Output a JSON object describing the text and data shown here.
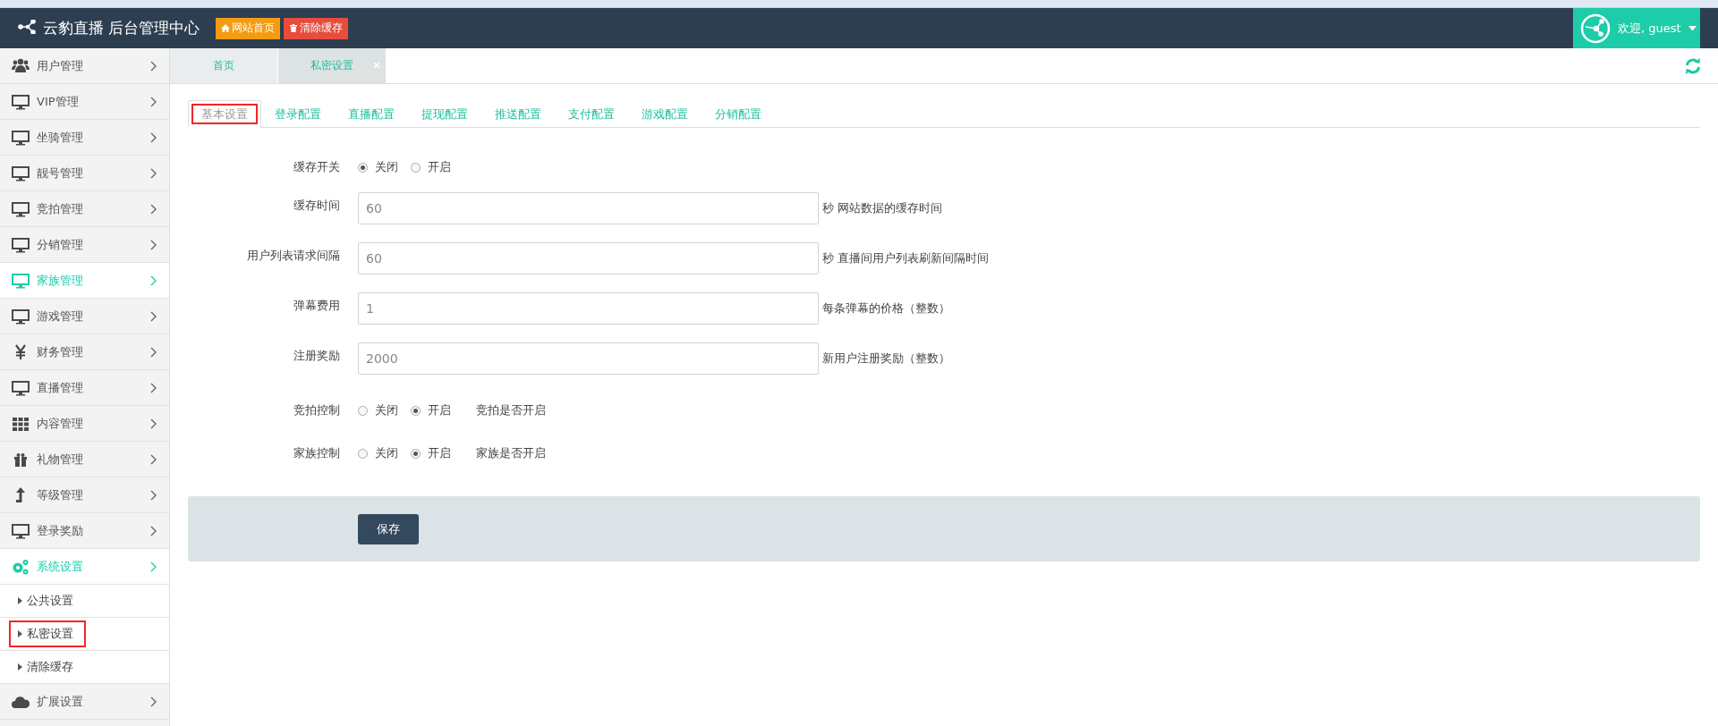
{
  "header": {
    "title": "云豹直播 后台管理中心",
    "buttons": [
      {
        "label": "网站首页",
        "kind": "home"
      },
      {
        "label": "清除缓存",
        "kind": "clear"
      }
    ],
    "user": {
      "greeting": "欢迎, guest"
    }
  },
  "sidebar": {
    "items": [
      {
        "label": "用户管理",
        "kind": "users",
        "active": false
      },
      {
        "label": "VIP管理",
        "kind": "monitor",
        "active": false
      },
      {
        "label": "坐骑管理",
        "kind": "monitor",
        "active": false
      },
      {
        "label": "靓号管理",
        "kind": "monitor",
        "active": false
      },
      {
        "label": "竞拍管理",
        "kind": "monitor",
        "active": false
      },
      {
        "label": "分销管理",
        "kind": "monitor",
        "active": false
      },
      {
        "label": "家族管理",
        "kind": "monitor",
        "active": true
      },
      {
        "label": "游戏管理",
        "kind": "monitor",
        "active": false
      },
      {
        "label": "财务管理",
        "kind": "yen",
        "active": false
      },
      {
        "label": "直播管理",
        "kind": "monitor",
        "active": false
      },
      {
        "label": "内容管理",
        "kind": "grid",
        "active": false
      },
      {
        "label": "礼物管理",
        "kind": "gift",
        "active": false
      },
      {
        "label": "等级管理",
        "kind": "arrow",
        "active": false
      },
      {
        "label": "登录奖励",
        "kind": "monitor",
        "active": false
      },
      {
        "label": "系统设置",
        "kind": "gears",
        "active": true,
        "children": [
          {
            "label": "公共设置",
            "highlighted": false
          },
          {
            "label": "私密设置",
            "highlighted": true
          },
          {
            "label": "清除缓存",
            "highlighted": false
          }
        ]
      },
      {
        "label": "扩展设置",
        "kind": "cloud",
        "active": false
      }
    ]
  },
  "page_tabs": [
    {
      "label": "首页",
      "selected": false,
      "closable": false
    },
    {
      "label": "私密设置",
      "selected": true,
      "closable": true
    }
  ],
  "config_tabs": [
    {
      "label": "基本设置",
      "selected": true,
      "highlighted": true
    },
    {
      "label": "登录配置",
      "selected": false,
      "highlighted": false
    },
    {
      "label": "直播配置",
      "selected": false,
      "highlighted": false
    },
    {
      "label": "提现配置",
      "selected": false,
      "highlighted": false
    },
    {
      "label": "推送配置",
      "selected": false,
      "highlighted": false
    },
    {
      "label": "支付配置",
      "selected": false,
      "highlighted": false
    },
    {
      "label": "游戏配置",
      "selected": false,
      "highlighted": false
    },
    {
      "label": "分销配置",
      "selected": false,
      "highlighted": false
    }
  ],
  "form": {
    "rows": [
      {
        "kind": "radio",
        "label": "缓存开关",
        "options": [
          {
            "label": "关闭",
            "selected": true
          },
          {
            "label": "开启",
            "selected": false
          }
        ]
      },
      {
        "kind": "input",
        "label": "缓存时间",
        "value": "60",
        "hint": "秒 网站数据的缓存时间"
      },
      {
        "kind": "input",
        "label": "用户列表请求间隔",
        "value": "60",
        "hint": "秒 直播间用户列表刷新间隔时间"
      },
      {
        "kind": "input",
        "label": "弹幕费用",
        "value": "1",
        "hint": "每条弹幕的价格（整数）"
      },
      {
        "kind": "input",
        "label": "注册奖励",
        "value": "2000",
        "hint": "新用户注册奖励（整数）"
      },
      {
        "kind": "radio",
        "label": "竞拍控制",
        "options": [
          {
            "label": "关闭",
            "selected": false
          },
          {
            "label": "开启",
            "selected": true
          }
        ],
        "hint": "竞拍是否开启"
      },
      {
        "kind": "radio",
        "label": "家族控制",
        "options": [
          {
            "label": "关闭",
            "selected": false
          },
          {
            "label": "开启",
            "selected": true
          }
        ],
        "hint": "家族是否开启"
      }
    ],
    "save_button": "保存"
  }
}
